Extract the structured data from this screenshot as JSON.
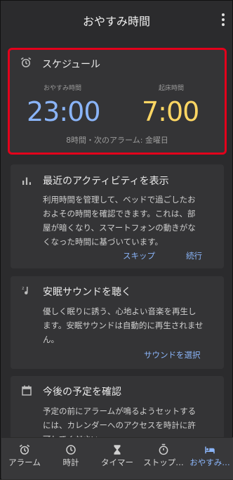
{
  "appbar": {
    "title": "おやすみ時間"
  },
  "schedule": {
    "title": "スケジュール",
    "bedtime_label": "おやすみ時間",
    "wake_label": "起床時間",
    "bedtime": "23:00",
    "wake": "7:00",
    "summary": "8時間・次のアラーム: 金曜日",
    "colors": {
      "bedtime": "#8ab4f8",
      "wake": "#fdd663",
      "highlight": "#e3001b"
    }
  },
  "activity": {
    "title": "最近のアクティビティを表示",
    "body_lines": [
      "利用時間を管理して、ベッドで過ごしたお",
      "およその時間を確認できます。これは、部",
      "屋が暗くなり、スマートフォンの動きがな",
      "くなった時間に基づいています。"
    ],
    "skip": "スキップ",
    "continue": "続行"
  },
  "sound": {
    "title": "安眠サウンドを聴く",
    "body_lines": [
      "優しく眠りに誘う、心地よい音楽を再生し",
      "ます。安眠サウンドは自動的に再生されませ",
      "ん。"
    ],
    "select": "サウンドを選択"
  },
  "calendar": {
    "title": "今後の予定を確認",
    "body_lines": [
      "予定の前にアラームが鳴るようセットする",
      "には、カレンダーへのアクセスを時計に許",
      "可してください"
    ]
  },
  "nav": {
    "items": [
      {
        "label": "アラーム",
        "icon": "alarm-icon"
      },
      {
        "label": "時計",
        "icon": "clock-icon"
      },
      {
        "label": "タイマー",
        "icon": "hourglass-icon"
      },
      {
        "label": "ストップ…",
        "icon": "stopwatch-icon"
      },
      {
        "label": "おやすみ…",
        "icon": "bed-icon",
        "active": true
      }
    ],
    "active_color": "#8ab4f8"
  }
}
